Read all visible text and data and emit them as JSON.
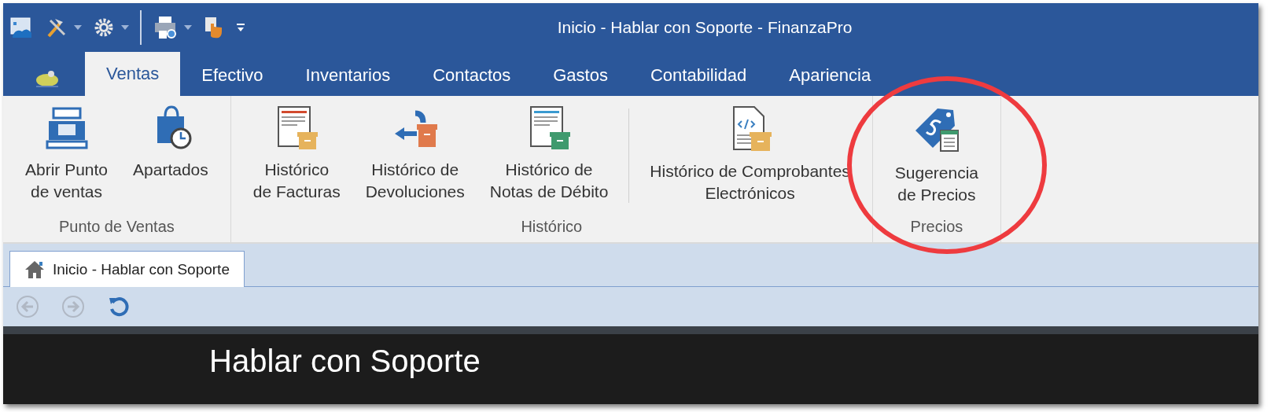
{
  "window": {
    "title": "Inicio - Hablar con Soporte - FinanzaPro"
  },
  "quick_access": [
    {
      "kind": "app",
      "dropdown": false
    },
    {
      "kind": "tools",
      "dropdown": true
    },
    {
      "kind": "gear",
      "dropdown": true
    },
    {
      "kind": "print",
      "dropdown": true
    },
    {
      "kind": "touch",
      "dropdown": false
    },
    {
      "kind": "customize",
      "dropdown": false
    }
  ],
  "tabs": [
    {
      "label": "Ventas",
      "selected": true
    },
    {
      "label": "Efectivo",
      "selected": false
    },
    {
      "label": "Inventarios",
      "selected": false
    },
    {
      "label": "Contactos",
      "selected": false
    },
    {
      "label": "Gastos",
      "selected": false
    },
    {
      "label": "Contabilidad",
      "selected": false
    },
    {
      "label": "Apariencia",
      "selected": false
    }
  ],
  "ribbon_groups": [
    {
      "label": "Punto de Ventas",
      "buttons": [
        {
          "kind": "register",
          "label": "Abrir Punto\nde ventas"
        },
        {
          "kind": "bag",
          "label": "Apartados"
        }
      ]
    },
    {
      "label": "Histórico",
      "buttons": [
        {
          "kind": "invoice",
          "label": "Histórico\nde Facturas"
        },
        {
          "kind": "return",
          "label": "Histórico de\nDevoluciones"
        },
        {
          "kind": "debit",
          "label": "Histórico de\nNotas de Débito"
        },
        {
          "kind": "xml",
          "label": "Histórico de Comprobantes\nElectrónicos",
          "separator_before": true
        }
      ]
    },
    {
      "label": "Precios",
      "highlighted": true,
      "buttons": [
        {
          "kind": "tag",
          "label": "Sugerencia\nde Precios"
        }
      ]
    }
  ],
  "document_tabs": [
    {
      "label": "Inicio - Hablar con Soporte",
      "selected": true
    }
  ],
  "nav_buttons": [
    {
      "kind": "back",
      "disabled": true
    },
    {
      "kind": "forward",
      "disabled": true
    },
    {
      "kind": "refresh",
      "disabled": false
    }
  ],
  "content": {
    "heading": "Hablar con Soporte"
  }
}
